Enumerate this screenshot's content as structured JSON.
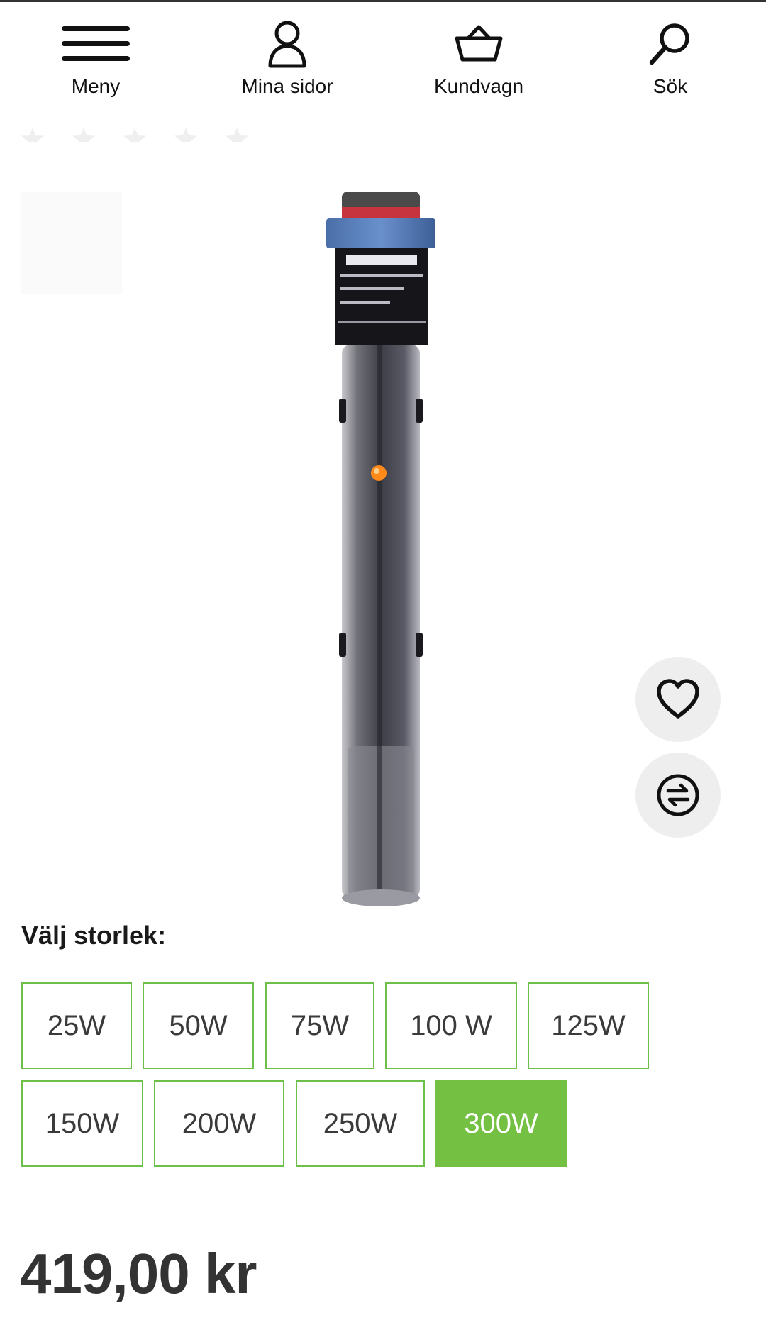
{
  "nav": {
    "menu_label": "Meny",
    "account_label": "Mina sidor",
    "cart_label": "Kundvagn",
    "search_label": "Sök"
  },
  "product": {
    "rating_stars": 5,
    "image_icon": "aquarium-heater-image"
  },
  "actions": {
    "favorite_icon": "heart-icon",
    "compare_icon": "compare-arrows-icon"
  },
  "sizes": {
    "title": "Välj storlek:",
    "options": [
      "25W",
      "50W",
      "75W",
      "100 W",
      "125W",
      "150W",
      "200W",
      "250W",
      "300W"
    ],
    "selected": "300W"
  },
  "price": "419,00 kr",
  "colors": {
    "accent_green": "#74c043",
    "border_green": "#6cc04a"
  }
}
